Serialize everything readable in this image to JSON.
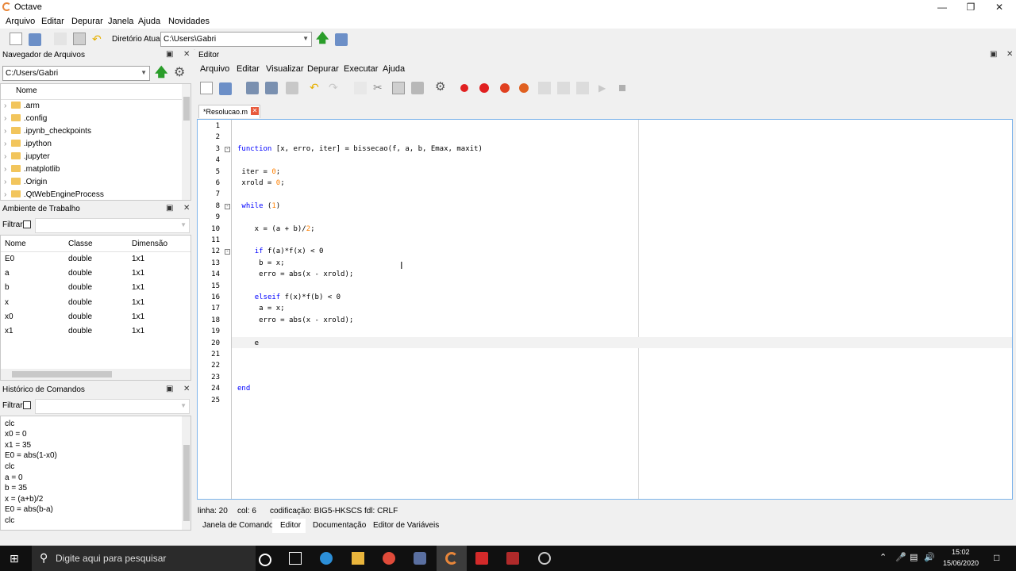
{
  "window": {
    "title": "Octave"
  },
  "menu": [
    "Arquivo",
    "Editar",
    "Depurar",
    "Janela",
    "Ajuda",
    "Novidades"
  ],
  "toolbar": {
    "dir_label": "Diretório Atual:",
    "dir_value": "C:\\Users\\Gabri"
  },
  "file_browser": {
    "title": "Navegador de Arquivos",
    "path": "C:/Users/Gabri",
    "column": "Nome",
    "items": [
      ".arm",
      ".config",
      ".ipynb_checkpoints",
      ".ipython",
      ".jupyter",
      ".matplotlib",
      ".Origin",
      ".QtWebEngineProcess"
    ]
  },
  "workspace": {
    "title": "Ambiente de Trabalho",
    "filter_label": "Filtrar",
    "columns": [
      "Nome",
      "Classe",
      "Dimensão"
    ],
    "rows": [
      [
        "E0",
        "double",
        "1x1"
      ],
      [
        "a",
        "double",
        "1x1"
      ],
      [
        "b",
        "double",
        "1x1"
      ],
      [
        "x",
        "double",
        "1x1"
      ],
      [
        "x0",
        "double",
        "1x1"
      ],
      [
        "x1",
        "double",
        "1x1"
      ]
    ]
  },
  "history": {
    "title": "Histórico de Comandos",
    "filter_label": "Filtrar",
    "items": [
      "clc",
      "x0 = 0",
      "x1 = 35",
      "E0 = abs(1-x0)",
      "clc",
      "a = 0",
      "b = 35",
      "x = (a+b)/2",
      "E0 = abs(b-a)",
      "clc"
    ]
  },
  "editor": {
    "title": "Editor",
    "menu": [
      "Arquivo",
      "Editar",
      "Visualizar",
      "Depurar",
      "Executar",
      "Ajuda"
    ],
    "tab": "*Resolucao.m",
    "lines": [
      "",
      "",
      "function [x, erro, iter] = bissecao(f, a, b, Emax, maxit)",
      "",
      " iter = 0;",
      " xrold = 0;",
      "",
      " while (1)",
      "",
      "    x = (a + b)/2;",
      "",
      "    if f(a)*f(x) < 0",
      "     b = x;",
      "     erro = abs(x - xrold);",
      "",
      "    elseif f(x)*f(b) < 0",
      "     a = x;",
      "     erro = abs(x - xrold);",
      "",
      "    e",
      "",
      "",
      "",
      "end",
      ""
    ],
    "status": {
      "line": "linha: 20",
      "col": "col: 6",
      "encoding": "codificação: BIG5-HKSCS",
      "eol": "fdl: CRLF"
    }
  },
  "bottom_tabs": [
    "Janela de Comandos",
    "Editor",
    "Documentação",
    "Editor de Variáveis"
  ],
  "taskbar": {
    "search": "Digite aqui para pesquisar",
    "time": "15:02",
    "date": "15/06/2020"
  }
}
